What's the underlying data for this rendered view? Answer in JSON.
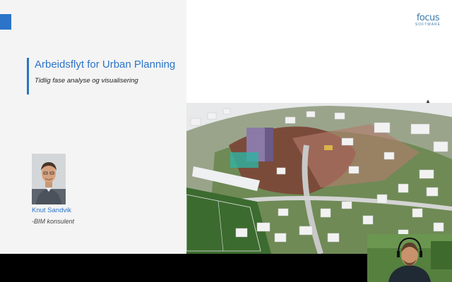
{
  "slide": {
    "title": "Arbeidsflyt for Urban Planning",
    "subtitle": "Tidlig fase analyse og visualisering"
  },
  "presenter": {
    "name": "Knut Sandvik",
    "role": "-BIM konsulent"
  },
  "logo": {
    "word": "focus",
    "sub": "SOFTWARE"
  },
  "icons": {
    "cursor": "mouse-cursor-icon"
  },
  "colors": {
    "accent": "#2b74c9",
    "background_left": "#f4f4f4",
    "letterbox": "#000000"
  }
}
